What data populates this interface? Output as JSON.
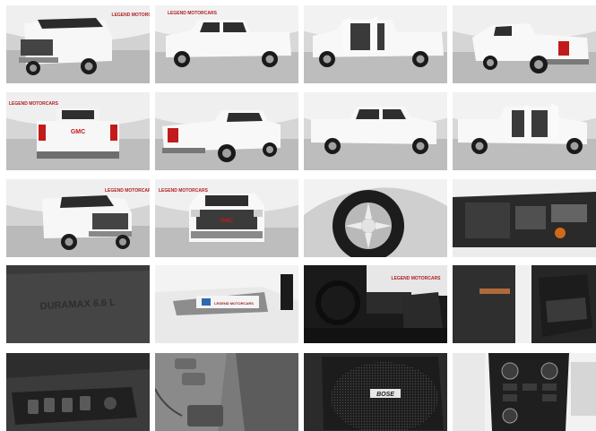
{
  "gallery": {
    "dealer_logo_text": "LEGEND MOTORCARS",
    "grille_badge": "GMC",
    "engine_cover_text": "DURAMAX 6.6 L",
    "speaker_badge": "BOSE",
    "sticker_text": "LEGEND MOTORCARS",
    "photos": [
      {
        "label": "front-three-quarter"
      },
      {
        "label": "driver-side-profile"
      },
      {
        "label": "driver-side-doors-open"
      },
      {
        "label": "rear-three-quarter-driver"
      },
      {
        "label": "rear-tailgate"
      },
      {
        "label": "rear-three-quarter-passenger"
      },
      {
        "label": "passenger-side-profile"
      },
      {
        "label": "passenger-side-doors-open"
      },
      {
        "label": "front-three-quarter-passenger"
      },
      {
        "label": "front-grille"
      },
      {
        "label": "wheel-tire"
      },
      {
        "label": "engine-bay"
      },
      {
        "label": "engine-cover"
      },
      {
        "label": "door-sill-emblem"
      },
      {
        "label": "interior-dashboard"
      },
      {
        "label": "door-panel-seats"
      },
      {
        "label": "window-switches"
      },
      {
        "label": "seat-controls"
      },
      {
        "label": "speaker-grille"
      },
      {
        "label": "center-console-controls"
      }
    ]
  }
}
